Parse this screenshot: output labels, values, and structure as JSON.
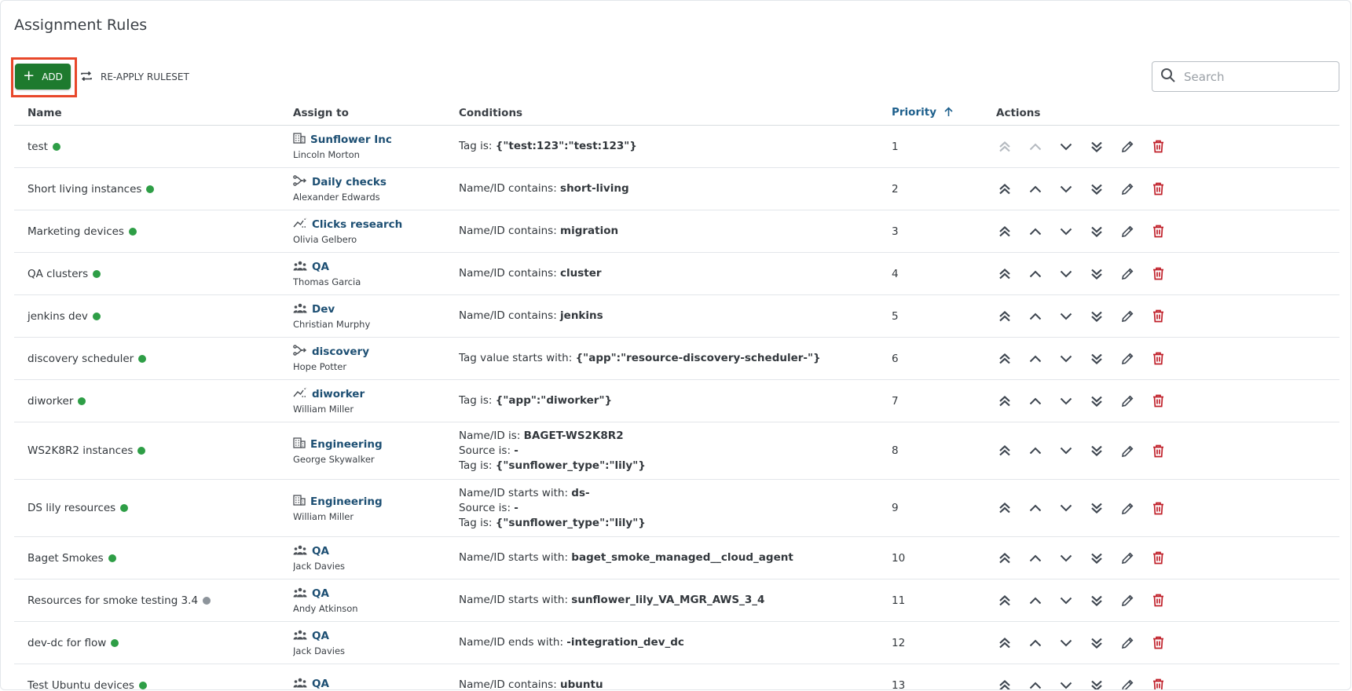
{
  "page": {
    "title": "Assignment Rules"
  },
  "toolbar": {
    "add_label": "ADD",
    "reapply_label": "RE-APPLY RULESET",
    "search_placeholder": "Search"
  },
  "table": {
    "headers": {
      "name": "Name",
      "assign_to": "Assign to",
      "conditions": "Conditions",
      "priority": "Priority",
      "actions": "Actions"
    },
    "colors": {
      "active": "#2e9e46",
      "inactive": "#8d949b",
      "link": "#1d4f73",
      "delete": "#c0202a"
    },
    "rows": [
      {
        "name": "test",
        "status": "active",
        "assign_icon": "building-icon",
        "assign_name": "Sunflower Inc",
        "owner": "Lincoln Morton",
        "conditions": [
          {
            "label": "Tag is: ",
            "value": "{\"test:123\":\"test:123\"}"
          }
        ],
        "priority": "1",
        "first": true
      },
      {
        "name": "Short living instances",
        "status": "active",
        "assign_icon": "branch-icon",
        "assign_name": "Daily checks",
        "owner": "Alexander Edwards",
        "conditions": [
          {
            "label": "Name/ID contains: ",
            "value": "short-living"
          }
        ],
        "priority": "2"
      },
      {
        "name": "Marketing devices",
        "status": "active",
        "assign_icon": "trend-icon",
        "assign_name": "Clicks research",
        "owner": "Olivia Gelbero",
        "conditions": [
          {
            "label": "Name/ID contains: ",
            "value": "migration"
          }
        ],
        "priority": "3"
      },
      {
        "name": "QA clusters",
        "status": "active",
        "assign_icon": "team-icon",
        "assign_name": "QA",
        "owner": "Thomas Garcia",
        "conditions": [
          {
            "label": "Name/ID contains: ",
            "value": "cluster"
          }
        ],
        "priority": "4"
      },
      {
        "name": "jenkins dev",
        "status": "active",
        "assign_icon": "team-icon",
        "assign_name": "Dev",
        "owner": "Christian Murphy",
        "conditions": [
          {
            "label": "Name/ID contains: ",
            "value": "jenkins"
          }
        ],
        "priority": "5"
      },
      {
        "name": "discovery scheduler",
        "status": "active",
        "assign_icon": "branch-icon",
        "assign_name": "discovery",
        "owner": "Hope Potter",
        "conditions": [
          {
            "label": "Tag value starts with: ",
            "value": "{\"app\":\"resource-discovery-scheduler-\"}"
          }
        ],
        "priority": "6"
      },
      {
        "name": "diworker",
        "status": "active",
        "assign_icon": "trend-icon",
        "assign_name": "diworker",
        "owner": "William Miller",
        "conditions": [
          {
            "label": "Tag is: ",
            "value": "{\"app\":\"diworker\"}"
          }
        ],
        "priority": "7"
      },
      {
        "name": "WS2K8R2 instances",
        "status": "active",
        "assign_icon": "building-icon",
        "assign_name": "Engineering",
        "owner": "George Skywalker",
        "conditions": [
          {
            "label": "Name/ID is: ",
            "value": "BAGET-WS2K8R2"
          },
          {
            "label": "Source is: ",
            "value": "-"
          },
          {
            "label": "Tag is: ",
            "value": "{\"sunflower_type\":\"lily\"}"
          }
        ],
        "priority": "8"
      },
      {
        "name": "DS lily resources",
        "status": "active",
        "assign_icon": "building-icon",
        "assign_name": "Engineering",
        "owner": "William Miller",
        "conditions": [
          {
            "label": "Name/ID starts with: ",
            "value": "ds-"
          },
          {
            "label": "Source is: ",
            "value": "-"
          },
          {
            "label": "Tag is: ",
            "value": "{\"sunflower_type\":\"lily\"}"
          }
        ],
        "priority": "9"
      },
      {
        "name": "Baget Smokes",
        "status": "active",
        "assign_icon": "team-icon",
        "assign_name": "QA",
        "owner": "Jack Davies",
        "conditions": [
          {
            "label": "Name/ID starts with: ",
            "value": "baget_smoke_managed__cloud_agent"
          }
        ],
        "priority": "10"
      },
      {
        "name": "Resources for smoke testing 3.4",
        "status": "inactive",
        "assign_icon": "team-icon",
        "assign_name": "QA",
        "owner": "Andy Atkinson",
        "conditions": [
          {
            "label": "Name/ID starts with: ",
            "value": "sunflower_lily_VA_MGR_AWS_3_4"
          }
        ],
        "priority": "11"
      },
      {
        "name": "dev-dc for flow",
        "status": "active",
        "assign_icon": "team-icon",
        "assign_name": "QA",
        "owner": "Jack Davies",
        "conditions": [
          {
            "label": "Name/ID ends with: ",
            "value": "-integration_dev_dc"
          }
        ],
        "priority": "12"
      },
      {
        "name": "Test Ubuntu devices",
        "status": "active",
        "assign_icon": "team-icon",
        "assign_name": "QA",
        "owner": "",
        "conditions": [
          {
            "label": "Name/ID contains: ",
            "value": "ubuntu"
          }
        ],
        "priority": "13"
      }
    ]
  }
}
